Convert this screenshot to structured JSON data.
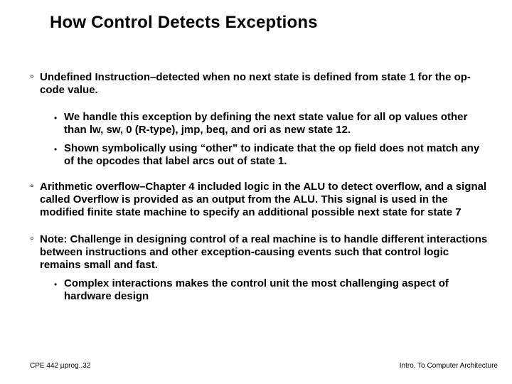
{
  "title": "How Control Detects Exceptions",
  "bullets": [
    {
      "text": "Undefined Instruction–detected when no next state is defined from state 1 for the op-code value.",
      "subs": [
        "We handle this exception by defining the next state value for all op values other than lw, sw, 0 (R-type), jmp, beq, and ori as new state 12.",
        "Shown symbolically using “other” to indicate that the op field does not match any of the opcodes that label arcs out of state 1."
      ]
    },
    {
      "text": "Arithmetic overflow–Chapter 4 included logic in the ALU to detect overflow, and a signal called Overflow is provided as an output from the ALU. This signal is used in the modified finite state machine to specify an additional possible next state for state 7",
      "subs": []
    },
    {
      "text": "Note: Challenge in designing control of a real machine is to handle different interactions between instructions and other exception-causing events such that control logic remains small and fast.",
      "subs": [
        "Complex interactions makes the control unit the most challenging aspect of hardware design"
      ]
    }
  ],
  "footer": {
    "left": "CPE 442  µprog..32",
    "right": "Intro. To Computer Architecture"
  }
}
